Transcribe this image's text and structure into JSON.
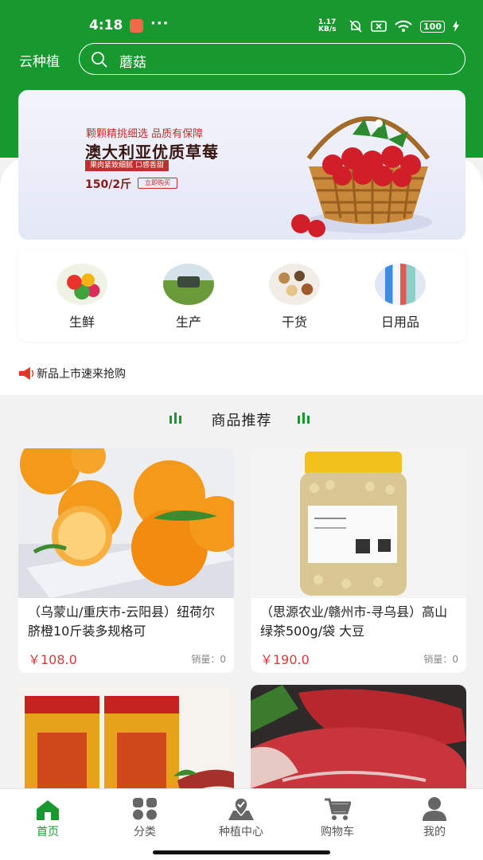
{
  "status_bar": {
    "time": "4:18",
    "network_speed": "1.17 KB/s",
    "battery": "100",
    "icons": [
      "bell-off-icon",
      "sim-icon",
      "wifi-icon",
      "battery-icon",
      "charging-icon"
    ]
  },
  "header": {
    "title": "云种植",
    "search": {
      "value": "蘑菇",
      "icon": "search-icon"
    }
  },
  "banner": {
    "line1": "颗颗精挑细选  品质有保障",
    "line2": "澳大利亚优质草莓",
    "ribbon": "果肉紧致细腻  口感香甜",
    "price": "150/2斤",
    "buy_label": "立即购买"
  },
  "categories": [
    {
      "label": "生鲜"
    },
    {
      "label": "生产"
    },
    {
      "label": "干货"
    },
    {
      "label": "日用品"
    }
  ],
  "notice": {
    "text": "新品上市速来抢购",
    "icon": "megaphone-icon"
  },
  "section": {
    "title": "商品推荐"
  },
  "products": [
    {
      "name": "（乌蒙山/重庆市-云阳县）纽荷尔脐橙10斤装多规格可",
      "price": "￥108.0",
      "sales": "销量：0"
    },
    {
      "name": "（思源农业/赣州市-寻乌县）高山绿茶500g/袋 大豆",
      "price": "￥190.0",
      "sales": "销量：0"
    },
    {
      "name": "",
      "price": "",
      "sales": ""
    },
    {
      "name": "",
      "price": "",
      "sales": ""
    }
  ],
  "bottom_nav": [
    {
      "label": "首页",
      "icon": "home-icon",
      "active": true
    },
    {
      "label": "分类",
      "icon": "grid-icon",
      "active": false
    },
    {
      "label": "种植中心",
      "icon": "map-pin-icon",
      "active": false
    },
    {
      "label": "购物车",
      "icon": "cart-icon",
      "active": false
    },
    {
      "label": "我的",
      "icon": "user-icon",
      "active": false
    }
  ],
  "colors": {
    "brand": "#17992f",
    "price": "#d9393a",
    "background": "#f2f2f2"
  }
}
